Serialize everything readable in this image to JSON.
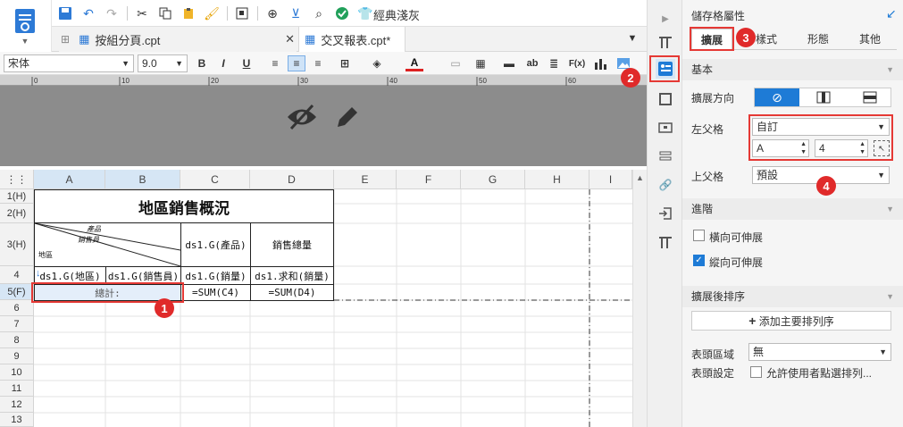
{
  "tabs": [
    {
      "label": "按組分頁.cpt"
    },
    {
      "label": "交叉報表.cpt*"
    }
  ],
  "toolbar": {
    "style_label": "經典淺灰"
  },
  "format": {
    "font": "宋体",
    "size": "9.0",
    "bold": "B",
    "italic": "I",
    "underline": "U",
    "ab": "ab",
    "fx": "F(x)"
  },
  "grid": {
    "columns": [
      "A",
      "B",
      "C",
      "D",
      "E",
      "F",
      "G",
      "H",
      "I"
    ],
    "rows": [
      "1(H)",
      "2(H)",
      "3(H)",
      "4",
      "5(F)",
      "6",
      "7",
      "8",
      "9",
      "10",
      "11",
      "12",
      "13"
    ],
    "title": "地區銷售概況",
    "slash_top": "產品",
    "slash_mid": "銷售員",
    "slash_bottom": "地區",
    "c3": "ds1.G(產品)",
    "d3": "銷售總量",
    "a4": "ds1.G(地區)",
    "b4": "ds1.G(銷售員)",
    "c4": "ds1.G(銷量)",
    "d4": "ds1.求和(銷量)",
    "a5": "總計:",
    "c5": "=SUM(C4)",
    "d5": "=SUM(D4)"
  },
  "panel": {
    "title": "儲存格屬性",
    "tabs": [
      "擴展",
      "樣式",
      "形態",
      "其他"
    ],
    "basic": "基本",
    "expand_dir": "擴展方向",
    "left_parent": "左父格",
    "left_parent_value": "自訂",
    "left_col": "A",
    "left_row": "4",
    "top_parent": "上父格",
    "top_parent_value": "預設",
    "advanced": "進階",
    "h_expand": "橫向可伸展",
    "v_expand": "縱向可伸展",
    "sort_section": "擴展後排序",
    "add_sort": "添加主要排列序",
    "header_area": "表頭區域",
    "header_area_value": "無",
    "header_setting": "表頭設定",
    "allow_sort": "允許使用者點選排列..."
  },
  "badges": [
    "1",
    "2",
    "3",
    "4"
  ],
  "colors": {
    "accent": "#1e7bd6",
    "badge": "#e02a2a"
  }
}
